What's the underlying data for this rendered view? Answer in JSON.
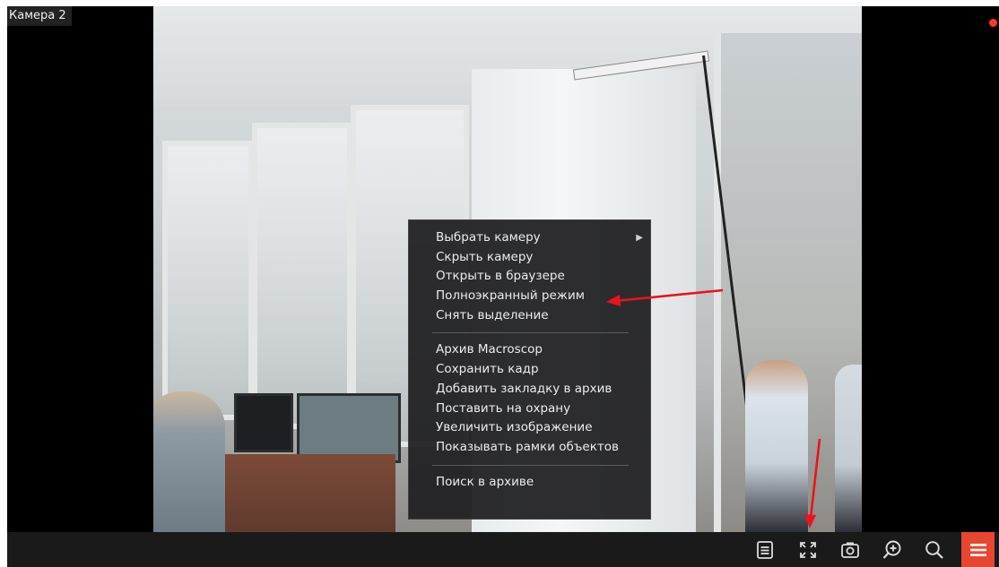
{
  "camera": {
    "title": "Камера 2",
    "recording_color": "#ff3c1a"
  },
  "context_menu": {
    "groups": [
      [
        {
          "label": "Выбрать камеру",
          "submenu": true
        },
        {
          "label": "Скрыть камеру"
        },
        {
          "label": "Открыть в браузере"
        },
        {
          "label": "Полноэкранный режим"
        },
        {
          "label": "Снять выделение"
        }
      ],
      [
        {
          "label": "Архив Macroscop"
        },
        {
          "label": "Сохранить кадр"
        },
        {
          "label": "Добавить закладку в архив"
        },
        {
          "label": "Поставить на охрану"
        },
        {
          "label": "Увеличить изображение"
        },
        {
          "label": "Показывать рамки объектов"
        }
      ],
      [
        {
          "label": "Поиск в архиве"
        }
      ]
    ]
  },
  "toolbar": {
    "buttons": [
      {
        "name": "layout-list-icon"
      },
      {
        "name": "fullscreen-icon"
      },
      {
        "name": "camera-snapshot-icon"
      },
      {
        "name": "zoom-in-icon"
      },
      {
        "name": "search-icon"
      },
      {
        "name": "hamburger-menu-icon",
        "accent": "#e8462e"
      }
    ]
  },
  "annotation_color": "#e8141e"
}
